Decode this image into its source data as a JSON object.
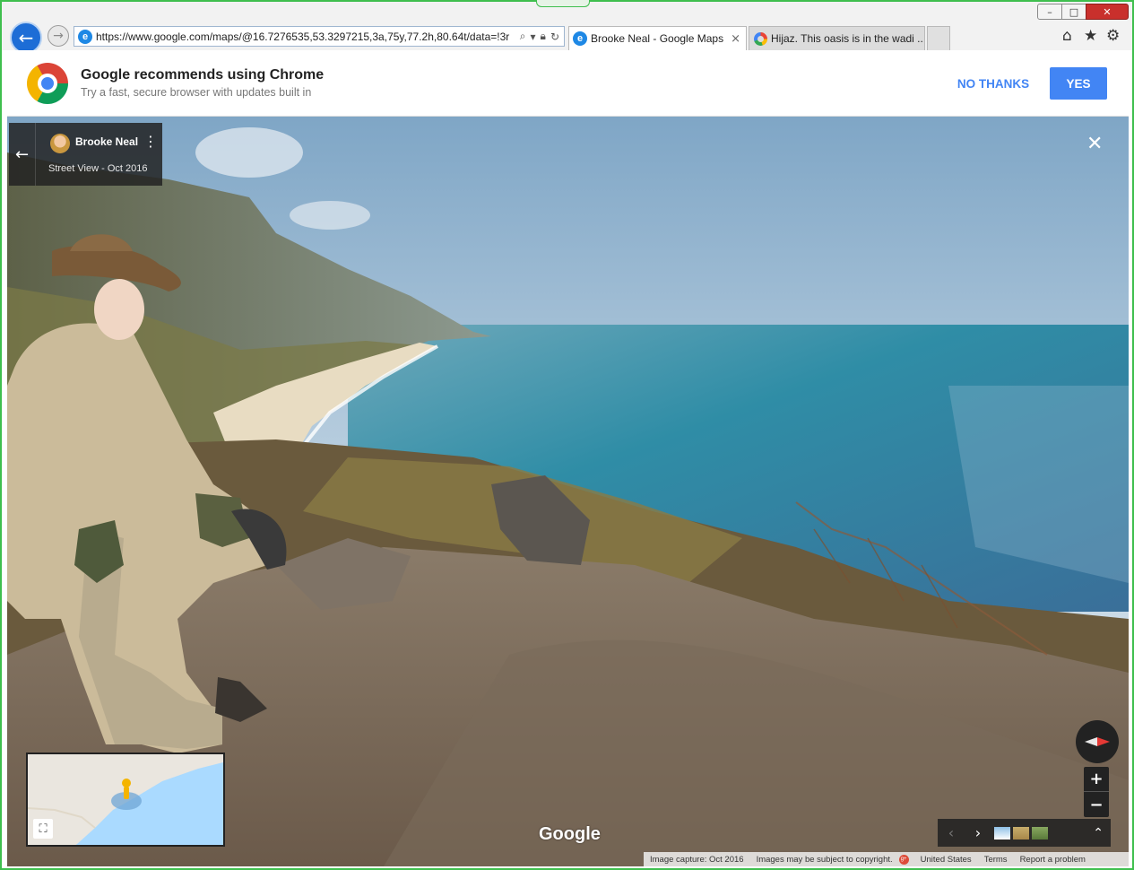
{
  "browser": {
    "url": "https://www.google.com/maps/@16.7276535,53.3297215,3a,75y,77.2h,80.64t/data=!3r",
    "tabs": [
      {
        "title": "Brooke Neal - Google Maps",
        "close": "×"
      },
      {
        "title": "Hijaz. This oasis is in the wadi ..."
      }
    ],
    "window_controls": {
      "minimize": "–",
      "maximize": "□",
      "close": "✕"
    },
    "icons": {
      "back": "arrow-left-icon",
      "forward": "arrow-right-icon",
      "home": "home-icon",
      "favorites": "star-icon",
      "tools": "gear-icon"
    }
  },
  "banner": {
    "title": "Google recommends using Chrome",
    "subtitle": "Try a fast, secure browser with updates built in",
    "no_thanks": "NO THANKS",
    "yes": "YES"
  },
  "street_view": {
    "contributor": "Brooke Neal",
    "date_label": "Street View - Oct 2016",
    "google_logo": "Google",
    "footer": {
      "capture": "Image capture: Oct 2016",
      "copyright": "Images may be subject to copyright.",
      "region": "United States",
      "terms": "Terms",
      "report": "Report a problem"
    },
    "controls": {
      "zoom_in": "+",
      "zoom_out": "−"
    }
  },
  "colors": {
    "accent": "#4285f4",
    "window_border": "#3fbf4e",
    "close_red": "#c9302c",
    "compass_red": "#e53935"
  }
}
